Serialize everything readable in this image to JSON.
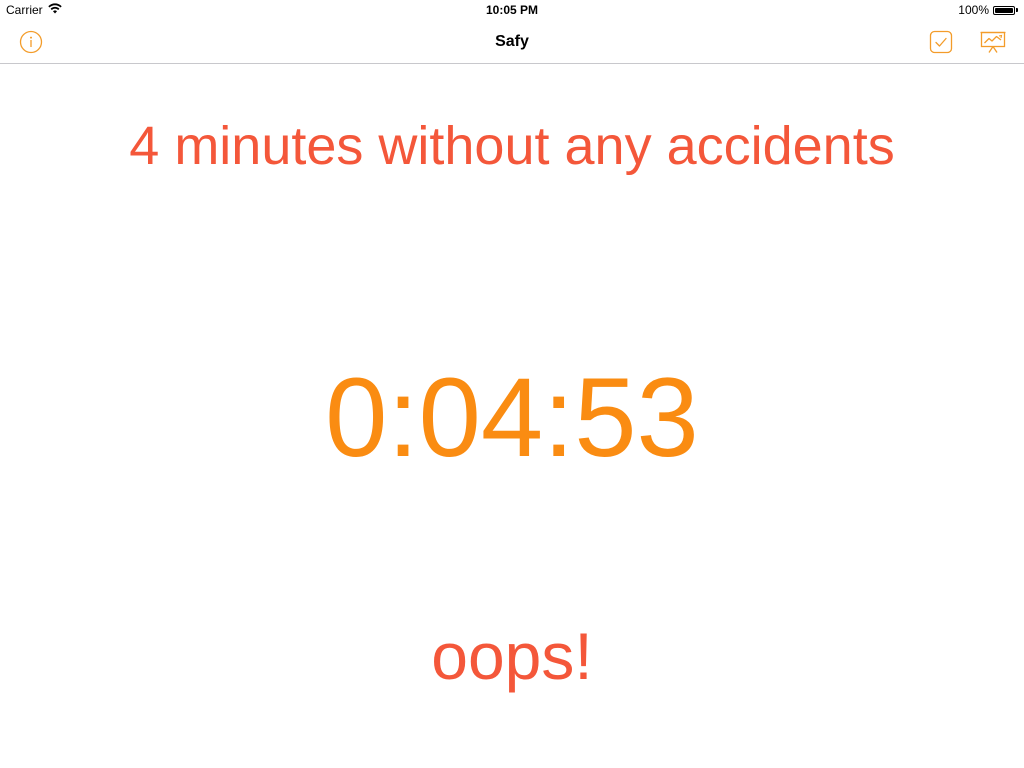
{
  "status_bar": {
    "carrier": "Carrier",
    "time": "10:05 PM",
    "battery_percent": "100%",
    "battery_level": 1.0
  },
  "nav": {
    "title": "Safy",
    "left_icon": "info-icon",
    "right_icons": [
      "checkmark-box-icon",
      "chart-presentation-icon"
    ]
  },
  "main": {
    "headline": "4 minutes without any accidents",
    "timer": "0:04:53",
    "action_label": "oops!"
  },
  "colors": {
    "accent_orange": "#fa8c12",
    "headline_red": "#f4573a",
    "icon_orange": "#f39c2a"
  }
}
